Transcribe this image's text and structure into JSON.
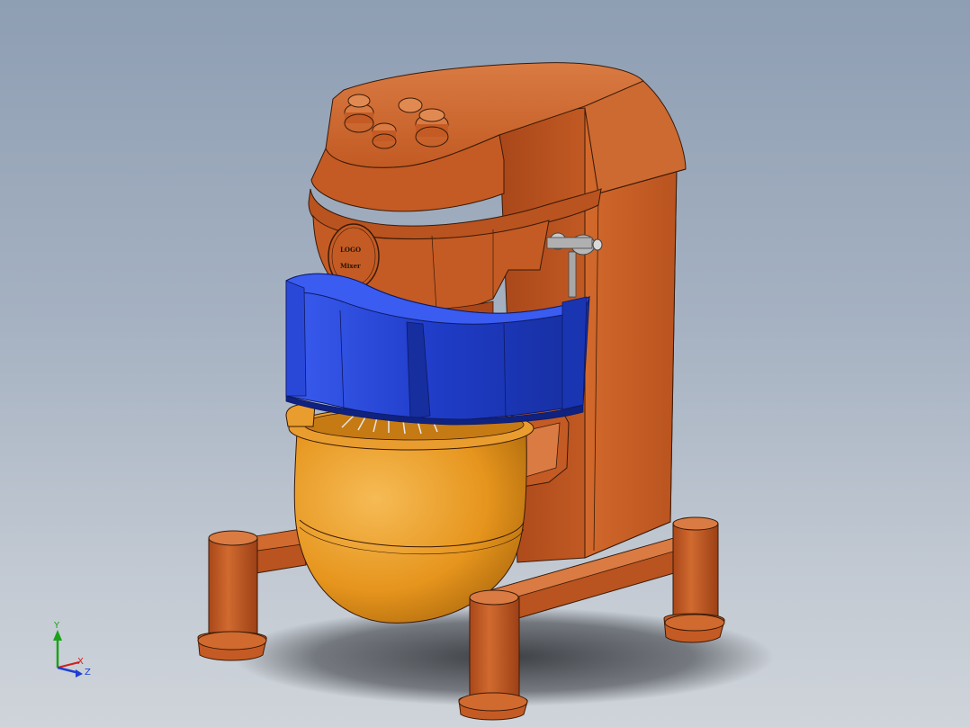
{
  "viewport": {
    "kind": "cad-3d-viewport",
    "background_top": "#8e9eb3",
    "background_bottom": "#cfd4da"
  },
  "model": {
    "subject": "planetary-mixer",
    "colors": {
      "body": "#c85f27",
      "body_dark": "#8c3d13",
      "body_light": "#d97b43",
      "edge": "#3a1a08",
      "guard": "#1f3cc7",
      "guard_dark": "#10208a",
      "guard_light": "#3a5cf0",
      "bowl": "#e6951d",
      "bowl_dark": "#b06a0c",
      "bowl_light": "#f3b24a",
      "shadow": "#3c3f44",
      "handle_metal": "#a8a8a8"
    },
    "logo": {
      "line1": "LOGO",
      "line2": "Mixer"
    }
  },
  "triad": {
    "y_label": "Y",
    "x_label": "X",
    "z_label": "Z",
    "y_color": "#1aa31a",
    "x_color": "#d21e1e",
    "z_color": "#1e3fd2"
  }
}
